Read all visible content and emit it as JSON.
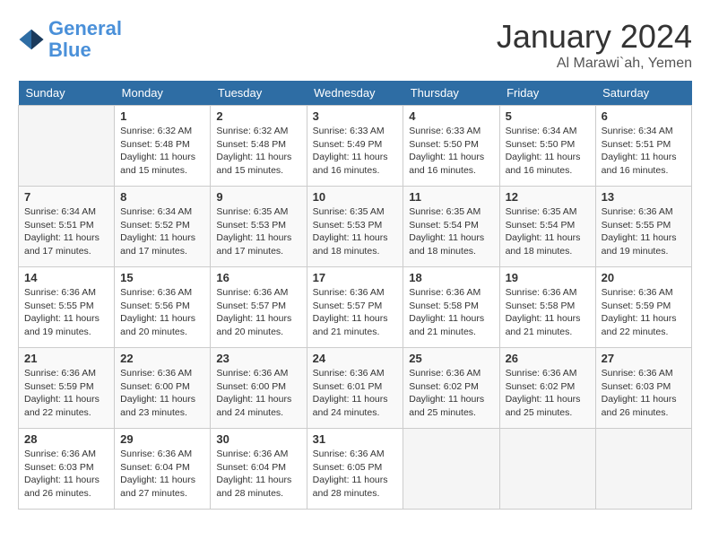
{
  "header": {
    "logo_line1": "General",
    "logo_line2": "Blue",
    "month": "January 2024",
    "location": "Al Marawi`ah, Yemen"
  },
  "weekdays": [
    "Sunday",
    "Monday",
    "Tuesday",
    "Wednesday",
    "Thursday",
    "Friday",
    "Saturday"
  ],
  "weeks": [
    [
      {
        "day": "",
        "sunrise": "",
        "sunset": "",
        "daylight": ""
      },
      {
        "day": "1",
        "sunrise": "Sunrise: 6:32 AM",
        "sunset": "Sunset: 5:48 PM",
        "daylight": "Daylight: 11 hours and 15 minutes."
      },
      {
        "day": "2",
        "sunrise": "Sunrise: 6:32 AM",
        "sunset": "Sunset: 5:48 PM",
        "daylight": "Daylight: 11 hours and 15 minutes."
      },
      {
        "day": "3",
        "sunrise": "Sunrise: 6:33 AM",
        "sunset": "Sunset: 5:49 PM",
        "daylight": "Daylight: 11 hours and 16 minutes."
      },
      {
        "day": "4",
        "sunrise": "Sunrise: 6:33 AM",
        "sunset": "Sunset: 5:50 PM",
        "daylight": "Daylight: 11 hours and 16 minutes."
      },
      {
        "day": "5",
        "sunrise": "Sunrise: 6:34 AM",
        "sunset": "Sunset: 5:50 PM",
        "daylight": "Daylight: 11 hours and 16 minutes."
      },
      {
        "day": "6",
        "sunrise": "Sunrise: 6:34 AM",
        "sunset": "Sunset: 5:51 PM",
        "daylight": "Daylight: 11 hours and 16 minutes."
      }
    ],
    [
      {
        "day": "7",
        "sunrise": "Sunrise: 6:34 AM",
        "sunset": "Sunset: 5:51 PM",
        "daylight": "Daylight: 11 hours and 17 minutes."
      },
      {
        "day": "8",
        "sunrise": "Sunrise: 6:34 AM",
        "sunset": "Sunset: 5:52 PM",
        "daylight": "Daylight: 11 hours and 17 minutes."
      },
      {
        "day": "9",
        "sunrise": "Sunrise: 6:35 AM",
        "sunset": "Sunset: 5:53 PM",
        "daylight": "Daylight: 11 hours and 17 minutes."
      },
      {
        "day": "10",
        "sunrise": "Sunrise: 6:35 AM",
        "sunset": "Sunset: 5:53 PM",
        "daylight": "Daylight: 11 hours and 18 minutes."
      },
      {
        "day": "11",
        "sunrise": "Sunrise: 6:35 AM",
        "sunset": "Sunset: 5:54 PM",
        "daylight": "Daylight: 11 hours and 18 minutes."
      },
      {
        "day": "12",
        "sunrise": "Sunrise: 6:35 AM",
        "sunset": "Sunset: 5:54 PM",
        "daylight": "Daylight: 11 hours and 18 minutes."
      },
      {
        "day": "13",
        "sunrise": "Sunrise: 6:36 AM",
        "sunset": "Sunset: 5:55 PM",
        "daylight": "Daylight: 11 hours and 19 minutes."
      }
    ],
    [
      {
        "day": "14",
        "sunrise": "Sunrise: 6:36 AM",
        "sunset": "Sunset: 5:55 PM",
        "daylight": "Daylight: 11 hours and 19 minutes."
      },
      {
        "day": "15",
        "sunrise": "Sunrise: 6:36 AM",
        "sunset": "Sunset: 5:56 PM",
        "daylight": "Daylight: 11 hours and 20 minutes."
      },
      {
        "day": "16",
        "sunrise": "Sunrise: 6:36 AM",
        "sunset": "Sunset: 5:57 PM",
        "daylight": "Daylight: 11 hours and 20 minutes."
      },
      {
        "day": "17",
        "sunrise": "Sunrise: 6:36 AM",
        "sunset": "Sunset: 5:57 PM",
        "daylight": "Daylight: 11 hours and 21 minutes."
      },
      {
        "day": "18",
        "sunrise": "Sunrise: 6:36 AM",
        "sunset": "Sunset: 5:58 PM",
        "daylight": "Daylight: 11 hours and 21 minutes."
      },
      {
        "day": "19",
        "sunrise": "Sunrise: 6:36 AM",
        "sunset": "Sunset: 5:58 PM",
        "daylight": "Daylight: 11 hours and 21 minutes."
      },
      {
        "day": "20",
        "sunrise": "Sunrise: 6:36 AM",
        "sunset": "Sunset: 5:59 PM",
        "daylight": "Daylight: 11 hours and 22 minutes."
      }
    ],
    [
      {
        "day": "21",
        "sunrise": "Sunrise: 6:36 AM",
        "sunset": "Sunset: 5:59 PM",
        "daylight": "Daylight: 11 hours and 22 minutes."
      },
      {
        "day": "22",
        "sunrise": "Sunrise: 6:36 AM",
        "sunset": "Sunset: 6:00 PM",
        "daylight": "Daylight: 11 hours and 23 minutes."
      },
      {
        "day": "23",
        "sunrise": "Sunrise: 6:36 AM",
        "sunset": "Sunset: 6:00 PM",
        "daylight": "Daylight: 11 hours and 24 minutes."
      },
      {
        "day": "24",
        "sunrise": "Sunrise: 6:36 AM",
        "sunset": "Sunset: 6:01 PM",
        "daylight": "Daylight: 11 hours and 24 minutes."
      },
      {
        "day": "25",
        "sunrise": "Sunrise: 6:36 AM",
        "sunset": "Sunset: 6:02 PM",
        "daylight": "Daylight: 11 hours and 25 minutes."
      },
      {
        "day": "26",
        "sunrise": "Sunrise: 6:36 AM",
        "sunset": "Sunset: 6:02 PM",
        "daylight": "Daylight: 11 hours and 25 minutes."
      },
      {
        "day": "27",
        "sunrise": "Sunrise: 6:36 AM",
        "sunset": "Sunset: 6:03 PM",
        "daylight": "Daylight: 11 hours and 26 minutes."
      }
    ],
    [
      {
        "day": "28",
        "sunrise": "Sunrise: 6:36 AM",
        "sunset": "Sunset: 6:03 PM",
        "daylight": "Daylight: 11 hours and 26 minutes."
      },
      {
        "day": "29",
        "sunrise": "Sunrise: 6:36 AM",
        "sunset": "Sunset: 6:04 PM",
        "daylight": "Daylight: 11 hours and 27 minutes."
      },
      {
        "day": "30",
        "sunrise": "Sunrise: 6:36 AM",
        "sunset": "Sunset: 6:04 PM",
        "daylight": "Daylight: 11 hours and 28 minutes."
      },
      {
        "day": "31",
        "sunrise": "Sunrise: 6:36 AM",
        "sunset": "Sunset: 6:05 PM",
        "daylight": "Daylight: 11 hours and 28 minutes."
      },
      {
        "day": "",
        "sunrise": "",
        "sunset": "",
        "daylight": ""
      },
      {
        "day": "",
        "sunrise": "",
        "sunset": "",
        "daylight": ""
      },
      {
        "day": "",
        "sunrise": "",
        "sunset": "",
        "daylight": ""
      }
    ]
  ]
}
